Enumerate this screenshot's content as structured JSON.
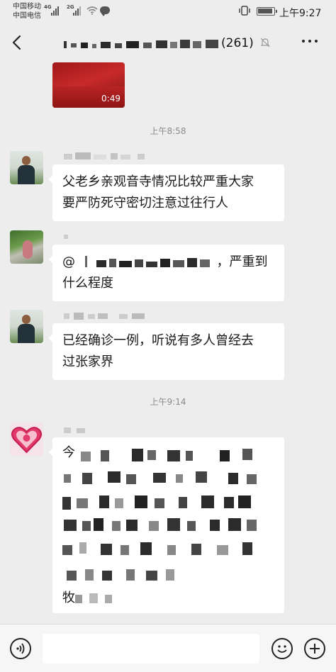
{
  "status_bar": {
    "carrier_1": "中国移动",
    "carrier_2": "中国电信",
    "net_1": "4G",
    "net_2": "2G",
    "time": "上午9:27"
  },
  "nav": {
    "title_count": "(261)",
    "back_icon": "chevron-left-icon",
    "mute_icon": "bell-muted-icon",
    "more_icon": "ellipsis-icon"
  },
  "messages": {
    "video": {
      "duration": "0:49"
    },
    "timestamp_1": "上午8:58",
    "msg_1": {
      "line_1": "父老乡亲观音寺情况比较严重大家",
      "line_2": "要严防死守密切注意过往行人"
    },
    "msg_2": {
      "mention": "@",
      "suffix": "，严重到",
      "line_2": "什么程度"
    },
    "msg_3": {
      "line_1": "已经确诊一例，听说有多人曾经去",
      "line_2": "过张家界"
    },
    "timestamp_2": "上午9:14",
    "msg_4": {
      "first_char": "今",
      "last_char": "牧"
    }
  },
  "input_bar": {
    "voice_icon": "voice-icon",
    "emoji_icon": "emoji-icon",
    "plus_icon": "plus-icon"
  },
  "colors": {
    "background": "#ededed",
    "bubble": "#ffffff",
    "timestamp": "#8a8a8a"
  }
}
